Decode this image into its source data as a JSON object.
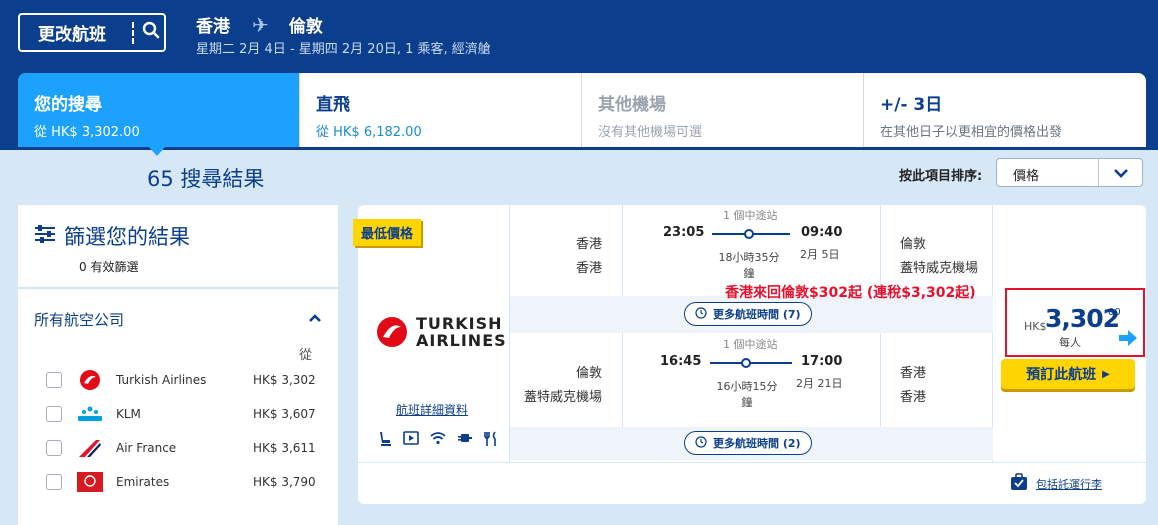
{
  "header": {
    "change_flight_label": "更改航班",
    "origin": "香港",
    "destination": "倫敦",
    "trip_summary": "星期二 2月 4日 - 星期四 2月 20日, 1 乘客, 經濟艙"
  },
  "tabs": [
    {
      "title": "您的搜尋",
      "sub": "從 HK$ 3,302.00"
    },
    {
      "title": "直飛",
      "sub": "從 HK$ 6,182.00"
    },
    {
      "title": "其他機場",
      "sub": "沒有其他機場可選"
    },
    {
      "title": "+/- 3日",
      "sub": "在其他日子以更相宜的價格出發"
    }
  ],
  "results_count": "65 搜尋結果",
  "sort": {
    "label": "按此項目排序:",
    "value": "價格"
  },
  "filter": {
    "title": "篩選您的結果",
    "active_count": "0 有效篩選",
    "airlines_heading": "所有航空公司",
    "from_label": "從",
    "airlines": [
      {
        "name": "Turkish Airlines",
        "price": "HK$ 3,302",
        "icon": "turkish-airlines-logo"
      },
      {
        "name": "KLM",
        "price": "HK$ 3,607",
        "icon": "klm-logo"
      },
      {
        "name": "Air France",
        "price": "HK$ 3,611",
        "icon": "air-france-logo"
      },
      {
        "name": "Emirates",
        "price": "HK$ 3,790",
        "icon": "emirates-logo"
      }
    ]
  },
  "result": {
    "badge": "最低價格",
    "airline_line1": "TURKISH",
    "airline_line2": "AIRLINES",
    "details_link": "航班詳細資料",
    "outbound": {
      "from_city": "香港",
      "from_airport": "香港",
      "depart_time": "23:05",
      "stops": "1 個中途站",
      "arrive_time": "09:40",
      "duration_line1": "18小時35分",
      "duration_line2": "鐘",
      "arrive_date": "2月 5日",
      "to_city": "倫敦",
      "to_airport": "蓋特威克機場",
      "more_times": "更多航班時間 (7)"
    },
    "inbound": {
      "from_city": "倫敦",
      "from_airport": "蓋特威克機場",
      "depart_time": "16:45",
      "stops": "1 個中途站",
      "arrive_time": "17:00",
      "duration_line1": "16小時15分",
      "duration_line2": "鐘",
      "arrive_date": "2月 21日",
      "to_city": "香港",
      "to_airport": "香港",
      "more_times": "更多航班時間 (2)"
    },
    "annotation": "香港來回倫敦$302起 (連稅$3,302起)",
    "currency": "HK$",
    "price": "3,302",
    "price_cents": "00",
    "per_person": "每人",
    "book_label": "預訂此航班",
    "baggage_link": "包括託運行李"
  },
  "colors": {
    "navy": "#0b3e8c",
    "accent": "#1da1ff",
    "highlight_red": "#e8112d",
    "yellow": "#ffd400"
  }
}
